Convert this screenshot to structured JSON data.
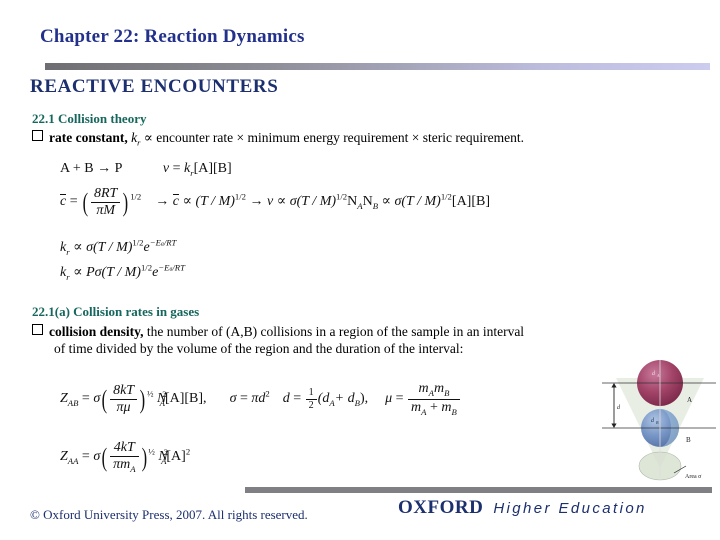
{
  "slide": {
    "chapter_title": "Chapter 22: Reaction Dynamics",
    "section_heading": "REACTIVE ENCOUNTERS",
    "accent_title_color": "#23318c",
    "accent_heading_color": "#1c2f6e",
    "accent_subheading_color": "#15665c",
    "rule_gradient_from": "#6e6e72",
    "rule_gradient_to": "#ccccef",
    "footer_rule_color": "#808084"
  },
  "sections": [
    {
      "id": "collision-theory",
      "heading": "22.1 Collision theory",
      "bullet": {
        "lead": "rate constant,",
        "math_inline": "k_r",
        "rest": "∝ encounter rate × minimum energy requirement × steric requirement."
      }
    },
    {
      "id": "collision-rates-in-gases",
      "heading": "22.1(a) Collision rates in gases",
      "bullet": {
        "lead": "collision density,",
        "line1": "the number of (A,B) collisions in a region of the sample in an interval",
        "line2": "of time divided by the volume of the region and the duration of the interval:"
      }
    }
  ],
  "equations": {
    "reaction": {
      "lhs": "A + B",
      "arrow": "→",
      "product": "P",
      "rate_law_v": "v",
      "rate_law_eq": "=",
      "rate_constant": "k",
      "rate_constant_sub": "r",
      "concentrations": "[A][B]"
    },
    "mean_speed": {
      "cbar": "c",
      "eq": "=",
      "num": "8RT",
      "den": "πM",
      "exp": "1/2",
      "arrow1": "→",
      "prop1": "∝",
      "term1": "(T / M)",
      "term1_exp": "1/2",
      "arrow2": "→",
      "v": "v",
      "prop2": "∝",
      "sigma": "σ",
      "term2": "(T / M)",
      "term2_exp": "1/2",
      "N_A": "N",
      "N_A_sub": "A",
      "N_B": "N",
      "N_B_sub": "B",
      "prop3": "∝",
      "sigma2": "σ",
      "term3": "(T / M)",
      "term3_exp": "1/2",
      "conc": "[A][B]"
    },
    "k_arrhenius": {
      "k": "k",
      "k_sub": "r",
      "prop": "∝",
      "sigma": "σ",
      "term": "(T / M)",
      "term_exp": "1/2",
      "exp_e": "e",
      "exp_arg": "−E",
      "exp_arg_sub": "a",
      "exp_arg_rest": "/RT"
    },
    "k_steric": {
      "k": "k",
      "k_sub": "r",
      "prop": "∝",
      "P": "P",
      "sigma": "σ",
      "term": "(T / M)",
      "term_exp": "1/2",
      "exp_e": "e",
      "exp_arg": "−E",
      "exp_arg_sub": "a",
      "exp_arg_rest": "/RT"
    },
    "Z_AB": {
      "Z": "Z",
      "Z_sub": "AB",
      "eq": "=",
      "sigma": "σ",
      "num": "8kT",
      "den": "πμ",
      "exp": "½",
      "N": "N",
      "N_sub": "A",
      "N_sup": "2",
      "conc": "[A][B],",
      "sigma2": "σ",
      "eq2": "=",
      "pi_d": "πd",
      "pi_d_sup": "2",
      "d": "d",
      "eq3": "=",
      "half_num": "1",
      "half_den": "2",
      "d_sum": "(d",
      "dA_sub": "A",
      "plus": "+ d",
      "dB_sub": "B",
      "close": "),",
      "mu": "μ",
      "eq4": "=",
      "mu_num_a": "m",
      "mu_num_a_sub": "A",
      "mu_num_b": "m",
      "mu_num_b_sub": "B",
      "mu_den_a": "m",
      "mu_den_a_sub": "A",
      "mu_den_plus": "+",
      "mu_den_b": "m",
      "mu_den_b_sub": "B"
    },
    "Z_AA": {
      "Z": "Z",
      "Z_sub": "AA",
      "eq": "=",
      "sigma": "σ",
      "num": "4kT",
      "den": "πm",
      "den_sub": "A",
      "exp": "½",
      "N": "N",
      "N_sub": "A",
      "N_sup": "2",
      "conc": "[A]",
      "conc_sup": "2"
    }
  },
  "figure": {
    "name": "collision-cross-section-diagram",
    "label_dA": "d",
    "label_dA_sub": "A",
    "label_dB": "d",
    "label_dB_sub": "B",
    "label_A": "A",
    "label_B": "B",
    "label_d": "d",
    "label_area": "Area σ",
    "sphere_a_color": "#9e3b63",
    "sphere_b_color": "#6e8fc4",
    "cone_color": "#cdd9c5"
  },
  "footer": {
    "copyright": "© Oxford University Press, 2007. All rights reserved.",
    "logo_word": "OXFORD",
    "logo_tagline": "Higher Education"
  }
}
